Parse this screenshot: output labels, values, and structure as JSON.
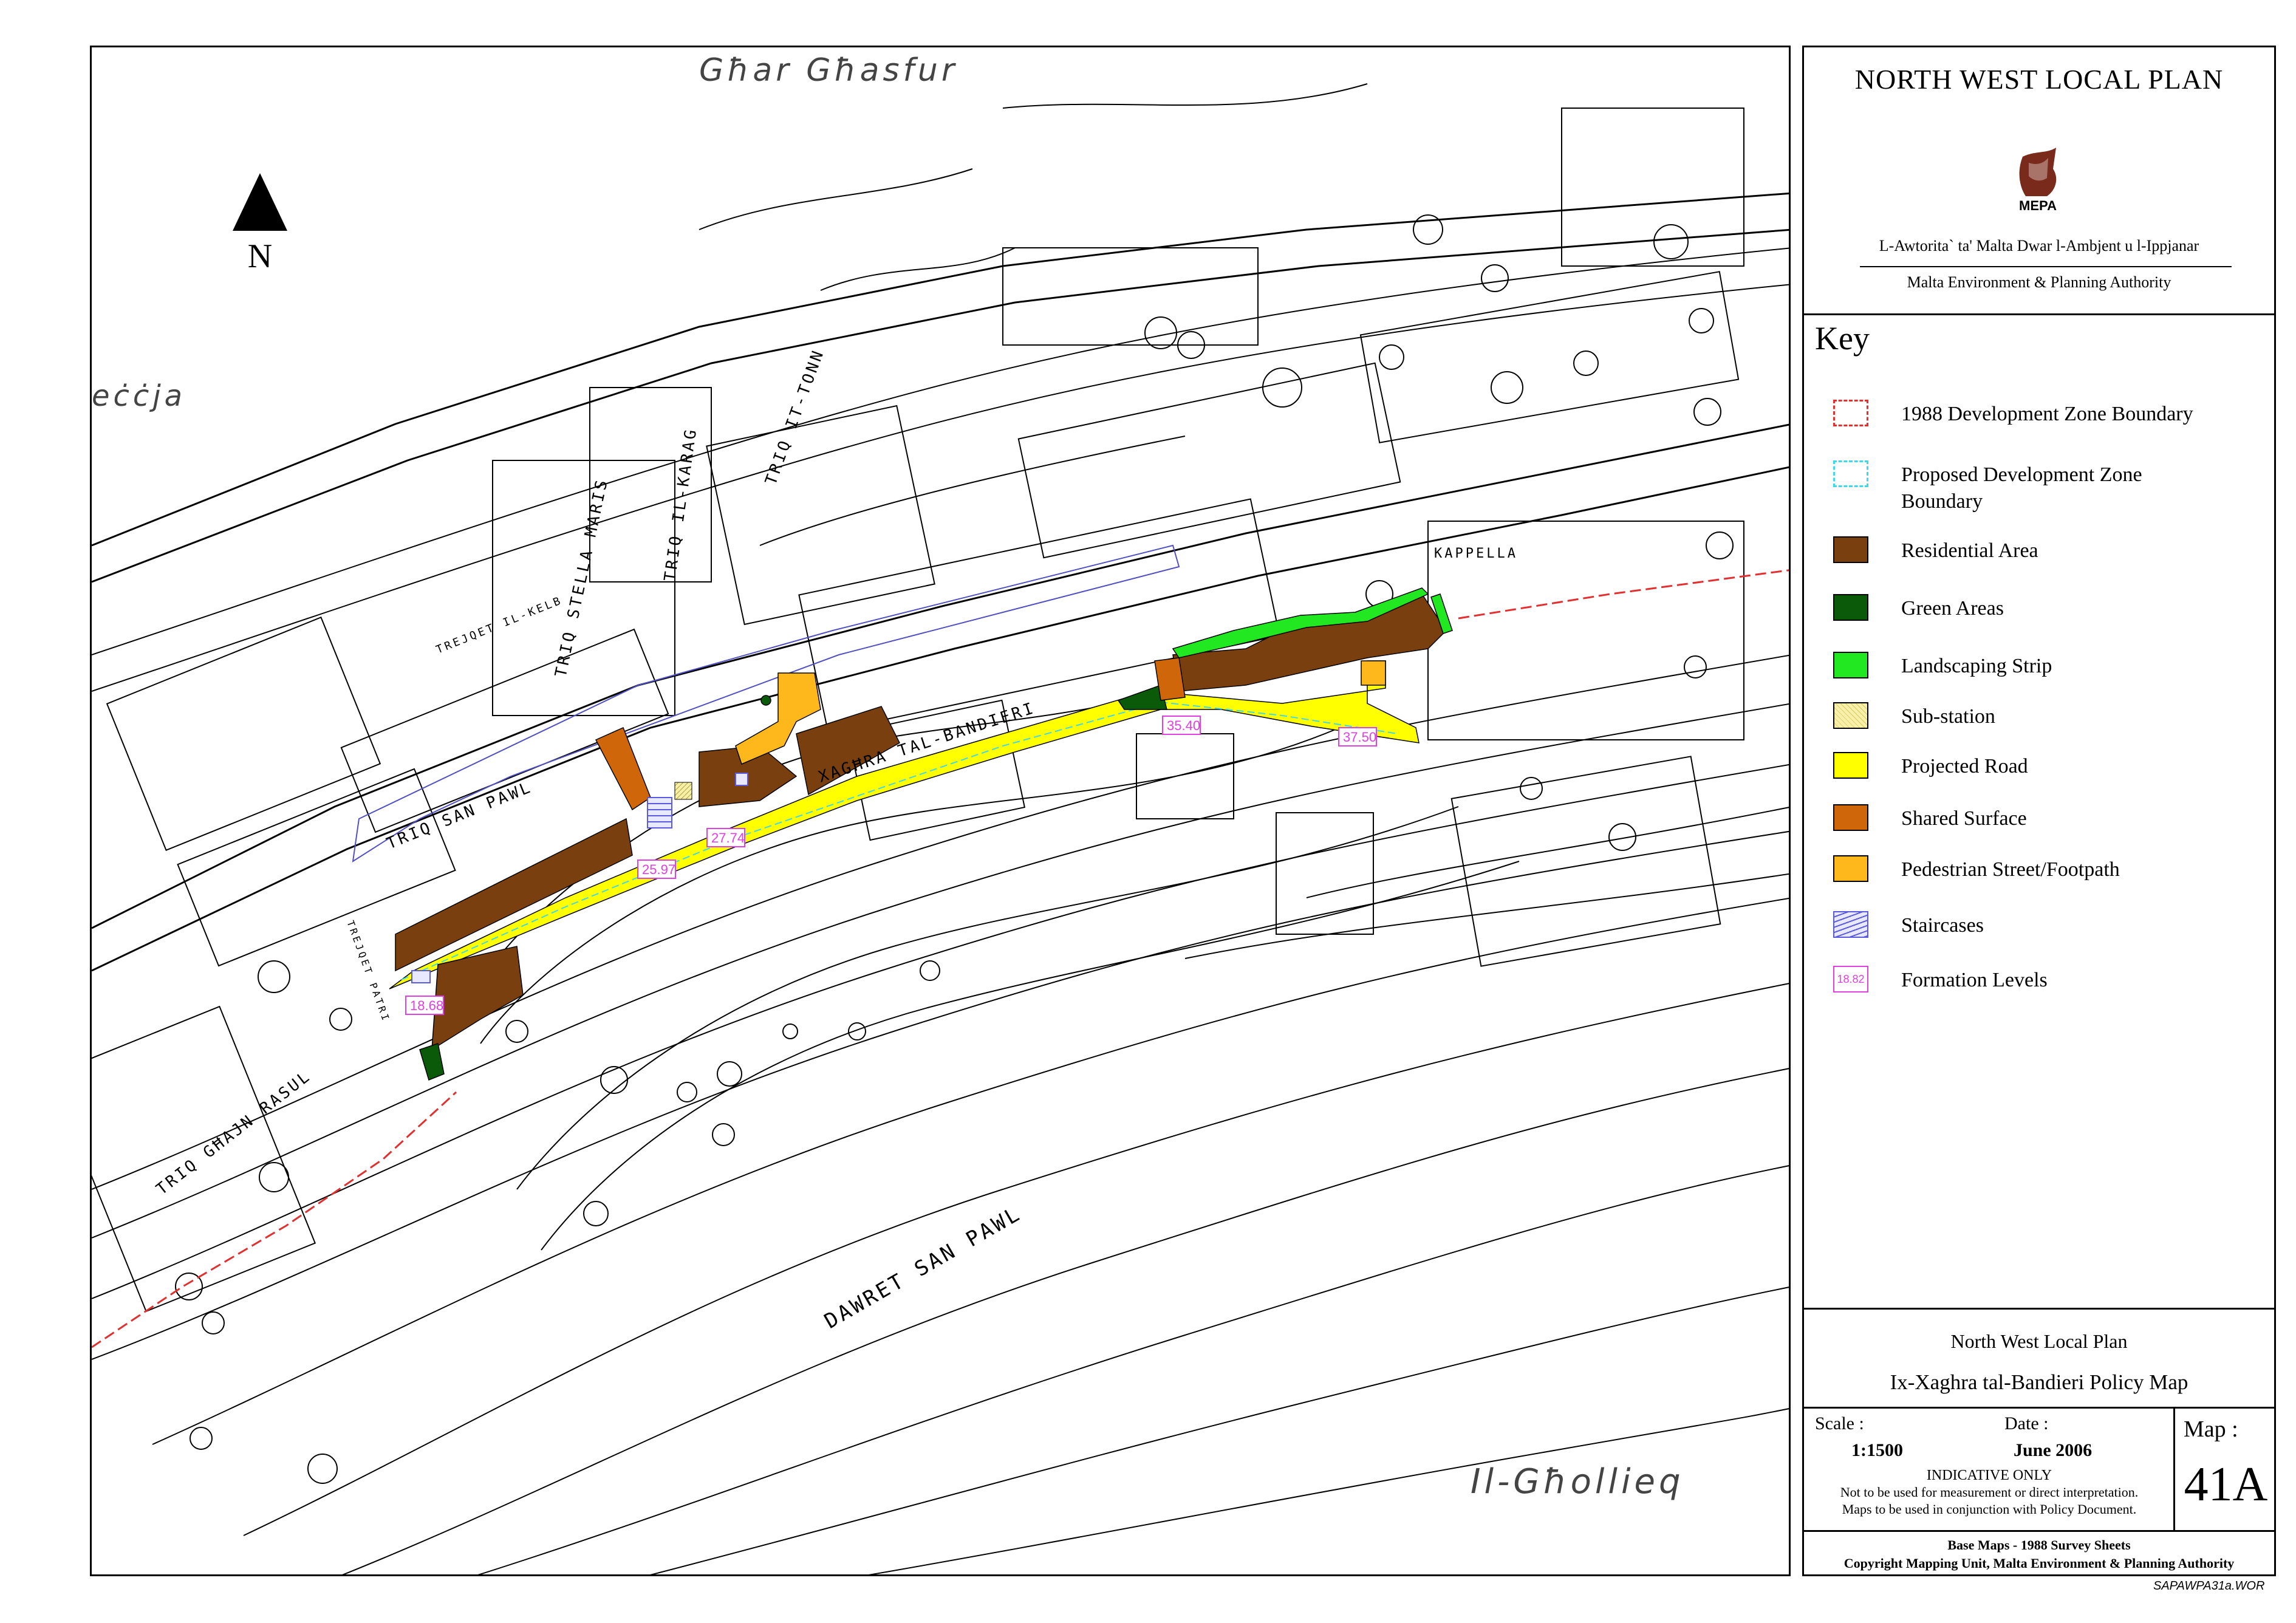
{
  "map": {
    "place_labels": {
      "ghar_ghasfur": "Għar Għasfur",
      "eccja": "eċċja",
      "il_ghollieq": "Il-Għollieq"
    },
    "street_labels": {
      "triq_san_pawl": "TRIQ SAN PAWL",
      "triq_stella_maris": "TRIQ STELLA MARIS",
      "triq_il_karag": "TRIQ IL-KARAG",
      "triq_it_tonn": "TRIQ IT-TONN",
      "trejqet_il_kelb": "TREJQET IL-KELB",
      "triq_ghajn_rasul": "TRIQ GĦAJN RASUL",
      "trejqet_patri": "TREJQET PATRI",
      "dawret_san_pawl": "DAWRET SAN PAWL",
      "xaghra_tal_bandieri": "XAGĦRA TAL-BANDIERI",
      "kappella": "KAPPELLA"
    },
    "north_label": "N",
    "formation_levels": [
      "18.68",
      "25.97",
      "27.74",
      "35.40",
      "37.50"
    ]
  },
  "panel": {
    "plan_title": "NORTH WEST LOCAL PLAN",
    "logo_text": "MEPA",
    "org_maltese": "L-Awtorita` ta' Malta Dwar l-Ambjent u l-Ippjanar",
    "org_english": "Malta Environment & Planning Authority",
    "key_title": "Key",
    "key_items": [
      {
        "label": "1988 Development Zone Boundary",
        "style": "dashed",
        "color": "#e03030"
      },
      {
        "label": "Proposed Development Zone",
        "label2": "Boundary",
        "style": "dashed",
        "color": "#40d8e8"
      },
      {
        "label": "Residential Area",
        "style": "fill",
        "color": "#7a3f0e"
      },
      {
        "label": "Green Areas",
        "style": "fill",
        "color": "#0a5a0a"
      },
      {
        "label": "Landscaping Strip",
        "style": "fill",
        "color": "#22e822"
      },
      {
        "label": "Sub-station",
        "style": "hatch",
        "color": "#f8f0a8"
      },
      {
        "label": "Projected Road",
        "style": "fill",
        "color": "#ffff00"
      },
      {
        "label": "Shared Surface",
        "style": "fill",
        "color": "#d0660a"
      },
      {
        "label": "Pedestrian Street/Footpath",
        "style": "fill",
        "color": "#ffb81c"
      },
      {
        "label": "Staircases",
        "style": "stairs",
        "color": "#5a5ae0"
      },
      {
        "label": "Formation Levels",
        "style": "level",
        "color": "#e040e0",
        "sample": "18.82"
      }
    ],
    "title_block": {
      "plan_name": "North West Local Plan",
      "map_title": "Ix-Xaghra tal-Bandieri Policy Map",
      "scale_label": "Scale :",
      "scale_value": "1:1500",
      "date_label": "Date :",
      "date_value": "June 2006",
      "indicative_1": "INDICATIVE ONLY",
      "indicative_2": "Not to be used for measurement or direct interpretation.",
      "indicative_3": "Maps to be used in conjunction with Policy Document.",
      "map_label": "Map :",
      "map_number": "41A",
      "base_maps": "Base Maps - 1988 Survey Sheets",
      "copyright": "Copyright Mapping Unit, Malta Environment & Planning Authority"
    }
  },
  "file_ref": "SAPAWPA31a.WOR"
}
